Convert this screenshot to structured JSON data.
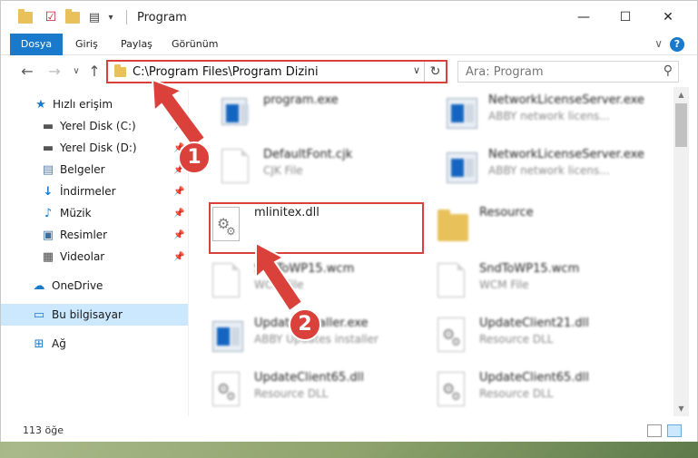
{
  "window": {
    "title": "Program",
    "minimize_glyph": "—",
    "maximize_glyph": "☐",
    "close_glyph": "✕"
  },
  "ribbon": {
    "tabs": [
      "Dosya",
      "Giriş",
      "Paylaş",
      "Görünüm"
    ],
    "help_glyph": "?",
    "collapse_glyph": "∨"
  },
  "nav": {
    "back_glyph": "←",
    "forward_glyph": "→",
    "recent_glyph": "∨",
    "up_glyph": "↑",
    "address": "C:\\Program Files\\Program Dizini",
    "address_dropdown_glyph": "∨",
    "refresh_glyph": "↻",
    "search_placeholder": "Ara: Program",
    "search_glyph": "⚲"
  },
  "sidebar": {
    "items": [
      {
        "label": "Hızlı erişim",
        "icon": "star-icon",
        "pinned": false
      },
      {
        "label": "Yerel Disk (C:)",
        "icon": "drive-icon",
        "pinned": true
      },
      {
        "label": "Yerel Disk (D:)",
        "icon": "drive-icon",
        "pinned": true
      },
      {
        "label": "Belgeler",
        "icon": "documents-icon",
        "pinned": true
      },
      {
        "label": "İndirmeler",
        "icon": "download-icon",
        "pinned": true
      },
      {
        "label": "Müzik",
        "icon": "music-icon",
        "pinned": true
      },
      {
        "label": "Resimler",
        "icon": "pictures-icon",
        "pinned": true
      },
      {
        "label": "Videolar",
        "icon": "videos-icon",
        "pinned": true
      },
      {
        "label": "OneDrive",
        "icon": "cloud-icon",
        "pinned": false
      },
      {
        "label": "Bu bilgisayar",
        "icon": "computer-icon",
        "pinned": false,
        "selected": true
      },
      {
        "label": "Ağ",
        "icon": "network-icon",
        "pinned": false
      }
    ],
    "pin_glyph": "📌"
  },
  "files": [
    {
      "name": "program.exe",
      "desc": "",
      "icon": "installer-icon"
    },
    {
      "name": "NetworkLicenseServer.exe",
      "desc": "ABBY network licens...",
      "icon": "app-icon"
    },
    {
      "name": "DefaultFont.cjk",
      "desc": "CJK File",
      "icon": "document-icon"
    },
    {
      "name": "NetworkLicenseServer.exe",
      "desc": "ABBY network licens...",
      "icon": "app-icon"
    },
    {
      "name": "mlinitex.dll",
      "desc": "",
      "icon": "dll-gear-icon"
    },
    {
      "name": "Resource",
      "desc": "",
      "icon": "folder-icon"
    },
    {
      "name": "SndToWP15.wcm",
      "desc": "WCM File",
      "icon": "document-icon"
    },
    {
      "name": "SndToWP15.wcm",
      "desc": "WCM File",
      "icon": "document-icon"
    },
    {
      "name": "UpdateInstaller.exe",
      "desc": "ABBY Updates installer",
      "icon": "app-icon"
    },
    {
      "name": "UpdateClient21.dll",
      "desc": "Resource DLL",
      "icon": "dll-gear-icon"
    },
    {
      "name": "UpdateClient65.dll",
      "desc": "Resource DLL",
      "icon": "dll-gear-icon"
    },
    {
      "name": "UpdateClient65.dll",
      "desc": "Resource DLL",
      "icon": "dll-gear-icon"
    }
  ],
  "status": {
    "item_count": "113 öğe"
  },
  "annotations": {
    "step1": "1",
    "step2": "2",
    "color": "#d9413a"
  },
  "colors": {
    "accent": "#1979ca",
    "selected_bg": "#cce8ff",
    "folder": "#e8c15a"
  }
}
